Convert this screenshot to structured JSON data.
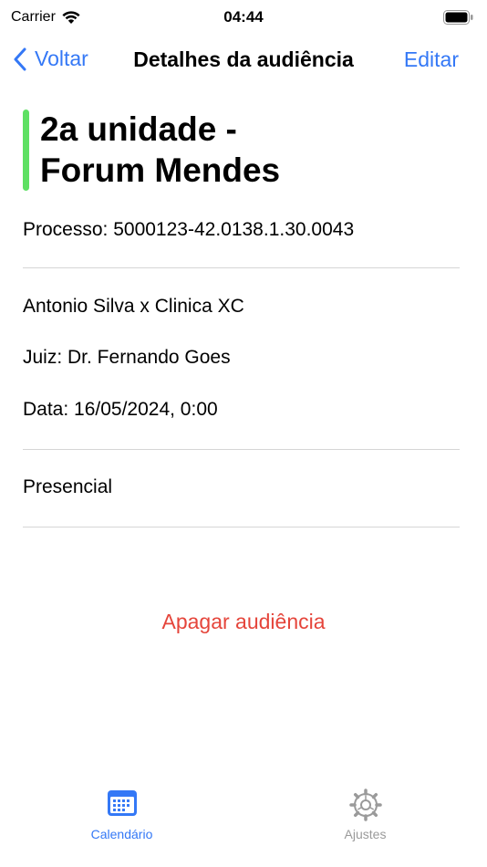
{
  "status_bar": {
    "carrier": "Carrier",
    "time": "04:44"
  },
  "nav": {
    "back_label": "Voltar",
    "title": "Detalhes da audiência",
    "edit_label": "Editar"
  },
  "hearing": {
    "title_line1": "2a unidade -",
    "title_line2": "Forum Mendes",
    "accent_color": "#5ee063",
    "process": "Processo: 5000123-42.0138.1.30.0043",
    "parties": "Antonio Silva x Clinica XC",
    "judge": "Juiz: Dr. Fernando Goes",
    "date": "Data: 16/05/2024, 0:00",
    "mode": "Presencial"
  },
  "actions": {
    "delete_label": "Apagar audiência"
  },
  "tabs": [
    {
      "label": "Calendário",
      "icon": "calendar-icon",
      "selected": true
    },
    {
      "label": "Ajustes",
      "icon": "gear-icon",
      "selected": false
    }
  ],
  "colors": {
    "accent": "#3478f6",
    "destructive": "#e5453b",
    "inactive_tab": "#9a9a9a"
  }
}
